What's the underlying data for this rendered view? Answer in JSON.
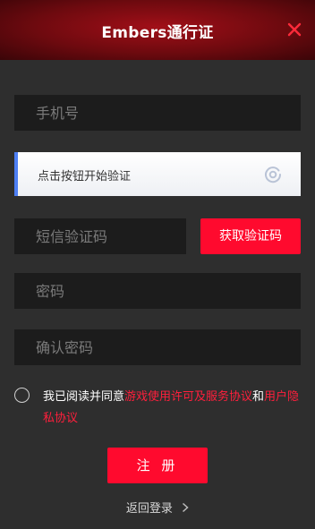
{
  "header": {
    "title": "Embers通行证",
    "close_icon": "close-icon"
  },
  "form": {
    "phone_placeholder": "手机号",
    "captcha_label": "点击按钮开始验证",
    "sms_code_placeholder": "短信验证码",
    "get_code_label": "获取验证码",
    "password_placeholder": "密码",
    "confirm_password_placeholder": "确认密码"
  },
  "agreement": {
    "prefix": "我已阅读并同意",
    "license_link": "游戏使用许可及服务协议",
    "and": "和",
    "privacy_link": "用户隐私协议",
    "checked": false
  },
  "actions": {
    "register_label": "注 册",
    "back_login_label": "返回登录"
  },
  "colors": {
    "accent": "#ff0a2e",
    "link": "#ff1f3c",
    "captcha_bar": "#4d7ff5",
    "background": "#2e2e2e",
    "field": "#1c1c1c"
  }
}
